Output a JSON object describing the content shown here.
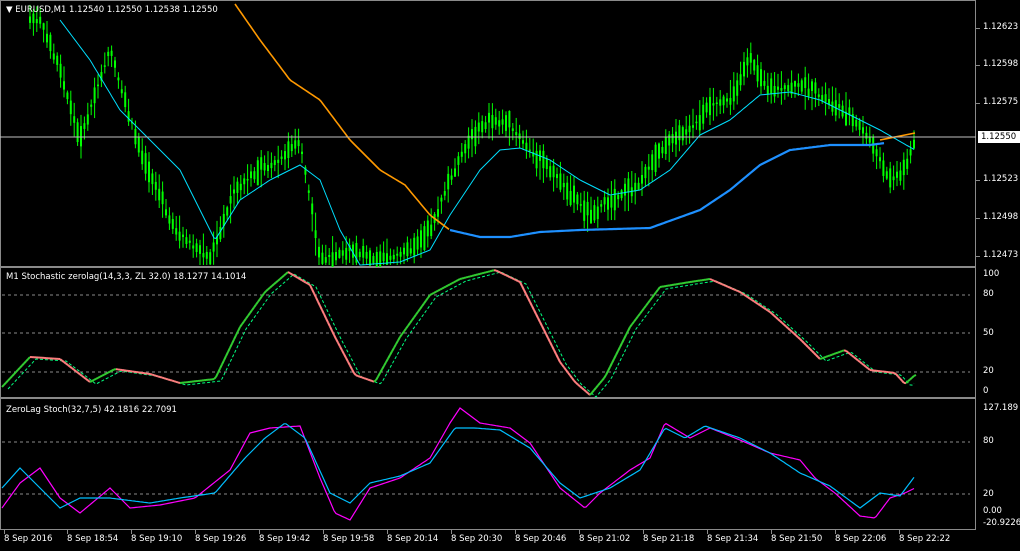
{
  "main": {
    "symbol_line": "EURUSD,M1  1.12540 1.12550 1.12538 1.12550",
    "current_price": "1.12550",
    "price_labels": [
      "1.12623",
      "1.12598",
      "1.12575",
      "1.12550",
      "1.12523",
      "1.12498",
      "1.12473"
    ],
    "colors": {
      "candles": "#00ff00",
      "fast_ma": "#00e0ff",
      "slow_ma": "#ff9900",
      "long_ma": "#1e90ff",
      "price_line": "#c0c0c0"
    }
  },
  "stoch1": {
    "title": "M1 Stochastic zerolag(14,3,3, ZL 32.0) 18.1277 14.1014",
    "levels": [
      "100",
      "80",
      "50",
      "20",
      "0"
    ],
    "colors": {
      "up": "#32cd32",
      "down": "#ff7f7f",
      "signal": "#00ff7f"
    }
  },
  "stoch2": {
    "title": "ZeroLag Stoch(32,7,5) 42.1816 22.7091",
    "levels": [
      "127.189",
      "80",
      "20",
      "0.00",
      "-20.9226"
    ],
    "colors": {
      "main": "#ff00ff",
      "signal": "#00bfff"
    }
  },
  "time_labels": [
    "8 Sep 2016",
    "8 Sep 18:54",
    "8 Sep 19:10",
    "8 Sep 19:26",
    "8 Sep 19:42",
    "8 Sep 19:58",
    "8 Sep 20:14",
    "8 Sep 20:30",
    "8 Sep 20:46",
    "8 Sep 21:02",
    "8 Sep 21:18",
    "8 Sep 21:34",
    "8 Sep 21:50",
    "8 Sep 22:06",
    "8 Sep 22:22"
  ]
}
